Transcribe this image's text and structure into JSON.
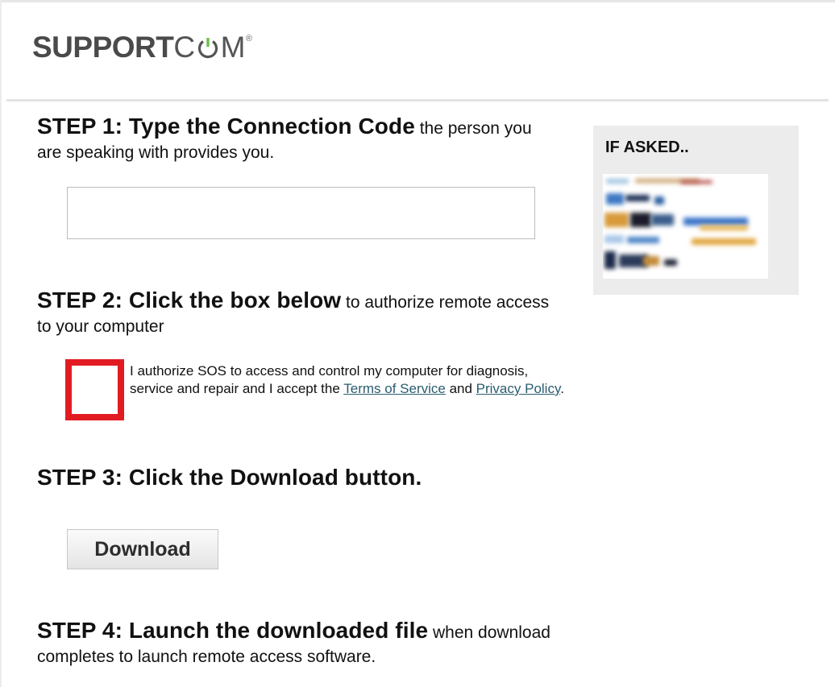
{
  "header": {
    "logo_bold": "SUPPORT",
    "logo_light": "C",
    "logo_tail": "M",
    "logo_tm": "®"
  },
  "step1": {
    "title": "STEP 1: Type the Connection Code",
    "rest": " the person you are speaking with provides you.",
    "input_value": "",
    "input_placeholder": ""
  },
  "step2": {
    "title": "STEP 2: Click the box below",
    "rest": " to authorize remote access to your computer",
    "checked": false,
    "auth_text_before": "I authorize SOS to access and control my computer for diagnosis, service and repair and I accept the ",
    "terms_link": "Terms of Service",
    "and_text": " and ",
    "privacy_link": "Privacy Policy",
    "auth_text_after": "."
  },
  "step3": {
    "title": "STEP 3: Click the Download button.",
    "button_label": "Download"
  },
  "step4": {
    "title": "STEP 4: Launch the downloaded file",
    "rest": " when download completes to launch remote access software."
  },
  "side_panel": {
    "title": "IF ASKED..",
    "image_icon": "blurred-screenshot-image"
  },
  "colors": {
    "accent_red": "#e21b23",
    "link": "#2a5d6f",
    "power_green": "#5cb85c",
    "panel_bg": "#ececec"
  }
}
